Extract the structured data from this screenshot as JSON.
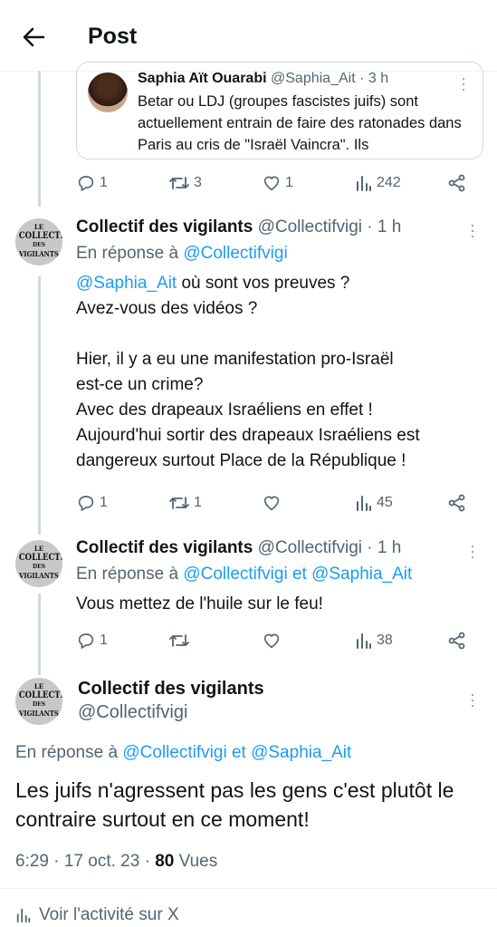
{
  "header": {
    "back_icon": "arrow-left-icon",
    "title": "Post"
  },
  "quoted": {
    "name": "Saphia Aït Ouarabi",
    "handle": "@Saphia_Ait",
    "time": "· 3 h",
    "text": "Betar ou LDJ (groupes fascistes juifs) sont actuellement entrain de faire des ratonades dans Paris au cris de \"Israël Vaincra\". Ils"
  },
  "tweet1_actions": {
    "replies": "1",
    "reposts": "3",
    "likes": "1",
    "views": "242"
  },
  "reply1": {
    "avatar_lines": [
      "LE",
      "COLLECTIF",
      "DES",
      "VIGILANTS"
    ],
    "name": "Collectif des vigilants",
    "handle": "@Collectifvigi",
    "time": "· 1 h",
    "reply_prefix": "En réponse à",
    "reply_mention": "@Collectifvigi",
    "mention": "@Saphia_Ait",
    "text_after_mention": " où sont vos preuves ?",
    "lines": [
      "Avez-vous des vidéos ?",
      "",
      "Hier, il y a eu une manifestation pro-Israël",
      "est-ce un crime?",
      "Avec des drapeaux Israéliens en effet !",
      "Aujourd'hui sortir des drapeaux Israéliens est",
      "dangereux surtout Place de la République !"
    ],
    "actions": {
      "replies": "1",
      "reposts": "1",
      "likes": "",
      "views": "45"
    }
  },
  "reply2": {
    "name": "Collectif des vigilants",
    "handle": "@Collectifvigi",
    "time": "· 1 h",
    "reply_prefix": "En réponse à",
    "reply_mention_1": "@Collectifvigi",
    "reply_and": " et ",
    "reply_mention_2": "@Saphia_Ait",
    "text": "Vous mettez de l'huile sur le feu!",
    "actions": {
      "replies": "1",
      "reposts": "",
      "likes": "",
      "views": "38"
    }
  },
  "main": {
    "name": "Collectif des vigilants",
    "handle": "@Collectifvigi",
    "reply_prefix": "En réponse à",
    "reply_mention_1": "@Collectifvigi",
    "reply_and": " et ",
    "reply_mention_2": "@Saphia_Ait",
    "text": "Les juifs n'agressent pas les gens c'est plutôt le contraire surtout en ce moment!",
    "time": "6:29 · 17 oct. 23 · ",
    "views_count": "80",
    "views_label": " Vues"
  },
  "activity_label": "Voir l'activité sur X",
  "colors": {
    "link": "#1d9bf0",
    "secondary": "#536471",
    "text": "#0f1419",
    "thread": "#cfd9de"
  }
}
